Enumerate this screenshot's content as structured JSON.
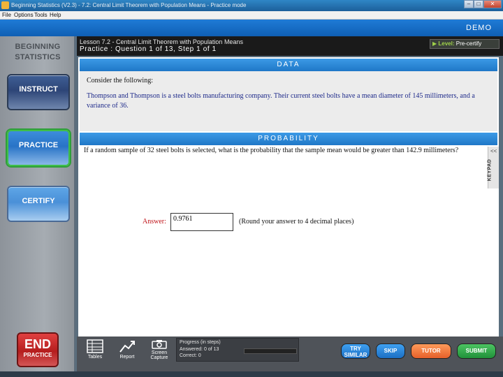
{
  "window": {
    "title": "Beginning Statistics (V2.3) - 7.2: Central Limit Theorem with Population Means - Practice mode"
  },
  "menu": [
    "File",
    "Options",
    "Tools",
    "Help"
  ],
  "banner": {
    "demo": "DEMO"
  },
  "sidebar": {
    "brand_line1": "BEGINNING",
    "brand_line2": "STATISTICS",
    "instruct": "INSTRUCT",
    "practice": "PRACTICE",
    "certify": "CERTIFY",
    "end_big": "END",
    "end_small": "PRACTICE"
  },
  "header": {
    "lesson": "Lesson 7.2 - Central Limit Theorem with Population Means",
    "step": "Practice : Question 1 of 13, Step 1 of 1",
    "level_label": "Level:",
    "level_value": "Pre-certify"
  },
  "data_section": {
    "title": "DATA",
    "consider": "Consider the following:",
    "problem": "Thompson and Thompson is a steel bolts manufacturing company.  Their current steel bolts have a mean diameter of 145 millimeters, and a variance of 36."
  },
  "probability_section": {
    "title": "PROBABILITY",
    "question": "If a random sample of 32 steel bolts is selected, what is the probability that the sample mean would be greater than 142.9 millimeters?"
  },
  "keypad": {
    "label": "KEYPAD",
    "arrow": "<<"
  },
  "answer": {
    "label": "Answer:",
    "value": "0.9761",
    "note": "(Round your answer to 4 decimal places)"
  },
  "toolbar": {
    "tables": "Tables",
    "report": "Report",
    "capture_line1": "Screen",
    "capture_line2": "Capture",
    "progress_title": "Progress (in steps)",
    "answered": "Answered:  0 of 13",
    "correct": "Correct:     0",
    "progress_fraction": 0,
    "try_line1": "TRY",
    "try_line2": "SIMILAR",
    "skip": "SKIP",
    "tutor": "TUTOR",
    "submit": "SUBMIT"
  }
}
